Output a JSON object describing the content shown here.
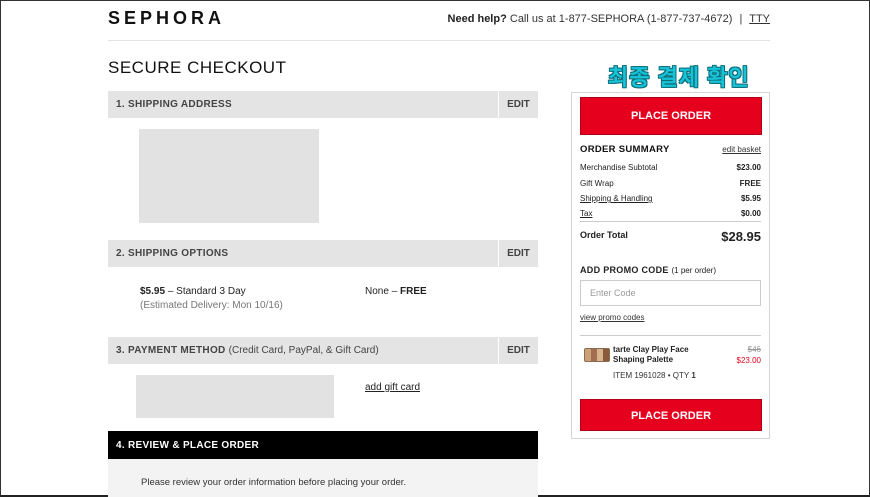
{
  "header": {
    "logo": "SEPHORA",
    "help_label": "Need help?",
    "help_text": "Call us at 1-877-SEPHORA (1-877-737-4672)",
    "separator": "|",
    "tty": "TTY"
  },
  "page_title": "SECURE CHECKOUT",
  "annotation": "최종 결제 확인",
  "sections": [
    {
      "label": "1. SHIPPING ADDRESS",
      "edit": "EDIT"
    },
    {
      "label": "2. SHIPPING OPTIONS",
      "edit": "EDIT"
    },
    {
      "label": "3. PAYMENT METHOD",
      "sublabel": "(Credit Card, PayPal, & Gift Card)",
      "edit": "EDIT"
    },
    {
      "label": "4. REVIEW & PLACE ORDER"
    }
  ],
  "shipping_option": {
    "price": "$5.95",
    "dash": "–",
    "name": "Standard 3 Day",
    "estimate": "(Estimated Delivery: Mon 10/16)",
    "alt_name": "None",
    "alt_price": "FREE"
  },
  "payment": {
    "add_gift_card": "add gift card"
  },
  "review": {
    "text": "Please review your order information before placing your order."
  },
  "summary": {
    "place_order": "PLACE ORDER",
    "title": "ORDER SUMMARY",
    "edit_basket": "edit basket",
    "rows": [
      {
        "label": "Merchandise Subtotal",
        "value": "$23.00"
      },
      {
        "label": "Gift Wrap",
        "value": "FREE"
      },
      {
        "label": "Shipping & Handling",
        "value": "$5.95"
      },
      {
        "label": "Tax",
        "value": "$0.00"
      }
    ],
    "total_label": "Order Total",
    "total_value": "$28.95",
    "promo_title": "ADD PROMO CODE",
    "promo_sub": "(1 per order)",
    "promo_placeholder": "Enter Code",
    "view_promo": "view promo codes",
    "item": {
      "name": "tarte Clay Play Face Shaping Palette",
      "old_price": "$46",
      "new_price": "$23.00",
      "item_label": "ITEM 1961028",
      "bullet": "•",
      "qty_label": "QTY",
      "qty": "1"
    }
  },
  "colors": {
    "brand_red": "#e5001e",
    "caption_cyan": "#19c3d7",
    "black_header": "#000000"
  }
}
